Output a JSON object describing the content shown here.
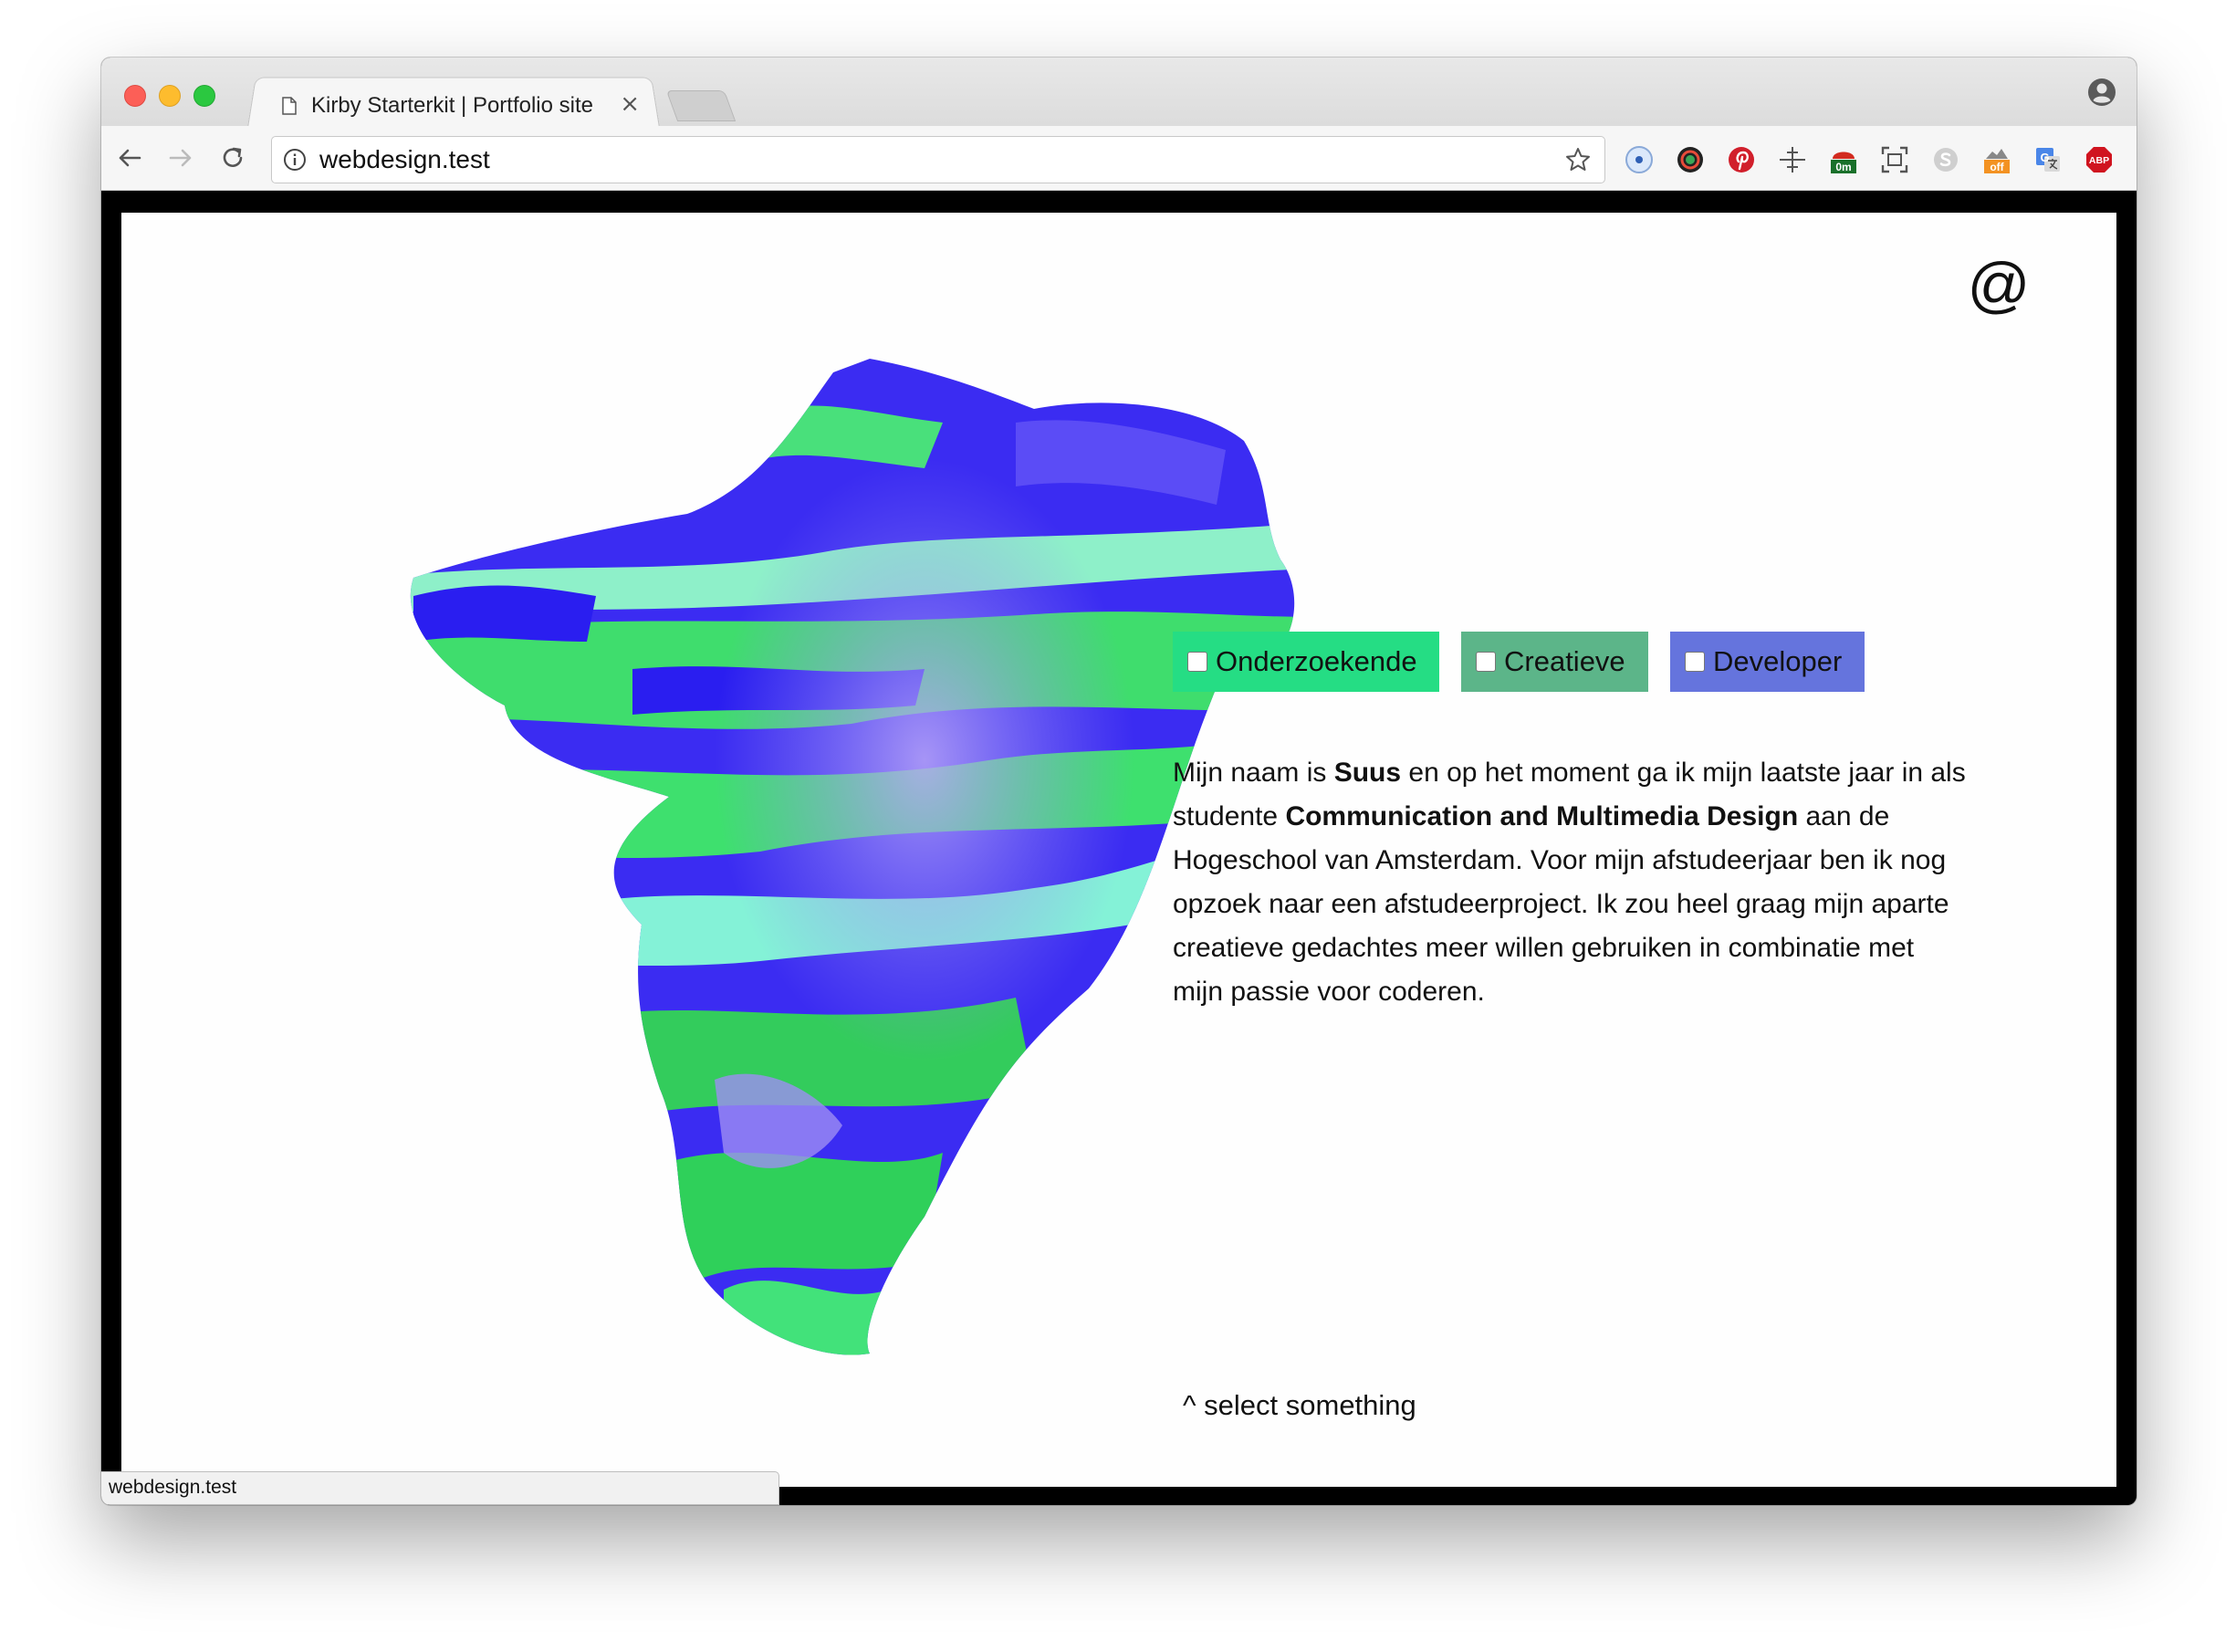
{
  "browser": {
    "tab_title": "Kirby Starterkit | Portfolio site",
    "tab_close": "×",
    "url": "webdesign.test",
    "status_url": "webdesign.test",
    "extensions": {
      "timer_badge": "0m",
      "off_badge": "off",
      "adblock_label": "ABP"
    }
  },
  "page": {
    "contact_symbol": "@",
    "roles": [
      {
        "label": "Onderzoekende",
        "color": "#25dd84",
        "checked": false
      },
      {
        "label": "Creatieve",
        "color": "#5cb589",
        "checked": false
      },
      {
        "label": "Developer",
        "color": "#6574dd",
        "checked": false
      }
    ],
    "bio": {
      "p1": "Mijn naam is ",
      "name": "Suus",
      "p2": " en op het moment ga ik mijn laatste jaar in als studente ",
      "study": "Communication and Multimedia Design",
      "p3": " aan de Hogeschool van Amsterdam. Voor mijn afstudeerjaar ben ik nog opzoek naar een afstudeerproject. Ik zou heel graag mijn aparte creatieve gedachtes meer willen gebruiken in combinatie met mijn passie voor coderen."
    },
    "hint": "^ select something"
  }
}
